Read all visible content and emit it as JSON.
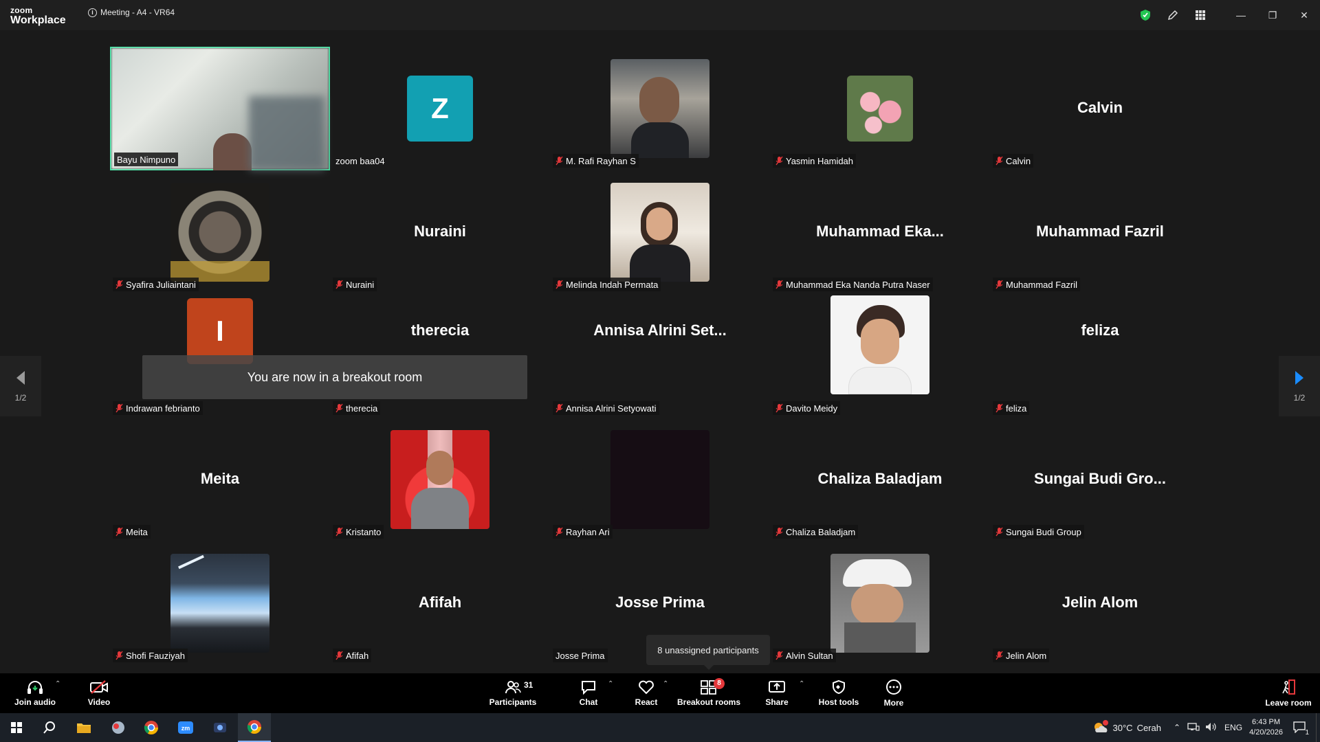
{
  "titlebar": {
    "brand_small": "zoom",
    "brand_big": "Workplace",
    "meeting_title": "Meeting - A4 - VR64"
  },
  "colors": {
    "speaker_border": "#3fe0a0",
    "avatar_z": "#12a0b2",
    "avatar_i": "#c0441c",
    "mute_red": "#e5383b"
  },
  "tiles": [
    {
      "label": "Bayu Nimpuno",
      "big": "",
      "muted": false
    },
    {
      "label": "zoom baa04",
      "big": "",
      "avatar": "Z",
      "muted": false
    },
    {
      "label": "M. Rafi Rayhan S",
      "big": "",
      "muted": true
    },
    {
      "label": "Yasmin Hamidah",
      "big": "",
      "muted": true
    },
    {
      "label": "Calvin",
      "big": "Calvin",
      "muted": true
    },
    {
      "label": "Syafira Juliaintani",
      "big": "",
      "muted": true
    },
    {
      "label": "Nuraini",
      "big": "Nuraini",
      "muted": true
    },
    {
      "label": "Melinda Indah Permata",
      "big": "",
      "muted": true
    },
    {
      "label": "Muhammad Eka Nanda Putra Naser",
      "big": "Muhammad  Eka...",
      "muted": true
    },
    {
      "label": "Muhammad Fazril",
      "big": "Muhammad Fazril",
      "muted": true
    },
    {
      "label": "Indrawan febrianto",
      "big": "",
      "avatar": "I",
      "muted": true
    },
    {
      "label": "therecia",
      "big": "therecia",
      "muted": true
    },
    {
      "label": "Annisa Alrini Setyowati",
      "big": "Annisa  Alrini  Set...",
      "muted": true
    },
    {
      "label": "Davito Meidy",
      "big": "",
      "muted": true
    },
    {
      "label": "feliza",
      "big": "feliza",
      "muted": true
    },
    {
      "label": "Meita",
      "big": "Meita",
      "muted": true
    },
    {
      "label": "Kristanto",
      "big": "",
      "muted": true
    },
    {
      "label": "Rayhan Ari",
      "big": "",
      "muted": true
    },
    {
      "label": "Chaliza Baladjam",
      "big": "Chaliza Baladjam",
      "muted": true
    },
    {
      "label": "Sungai Budi Group",
      "big": "Sungai  Budi  Gro...",
      "muted": true
    },
    {
      "label": "Shofi Fauziyah",
      "big": "",
      "muted": true
    },
    {
      "label": "Afifah",
      "big": "Afifah",
      "muted": true
    },
    {
      "label": "Josse Prima",
      "big": "Josse Prima",
      "muted": false
    },
    {
      "label": "Alvin Sultan",
      "big": "",
      "muted": true
    },
    {
      "label": "Jelin Alom",
      "big": "Jelin Alom",
      "muted": true
    }
  ],
  "pager": {
    "left": "1/2",
    "right": "1/2"
  },
  "toast": "You are now in a breakout room",
  "tooltip": "8 unassigned participants",
  "toolbar": {
    "join_audio": "Join audio",
    "video": "Video",
    "participants": "Participants",
    "participants_count": "31",
    "chat": "Chat",
    "react": "React",
    "breakout": "Breakout rooms",
    "breakout_badge": "8",
    "share": "Share",
    "host_tools": "Host tools",
    "more": "More",
    "leave": "Leave room"
  },
  "taskbar": {
    "weather_temp": "30°C",
    "weather_desc": "Cerah",
    "lang": "ENG",
    "time": "6:43 PM",
    "date": "4/20/2026",
    "notif_count": "1"
  }
}
